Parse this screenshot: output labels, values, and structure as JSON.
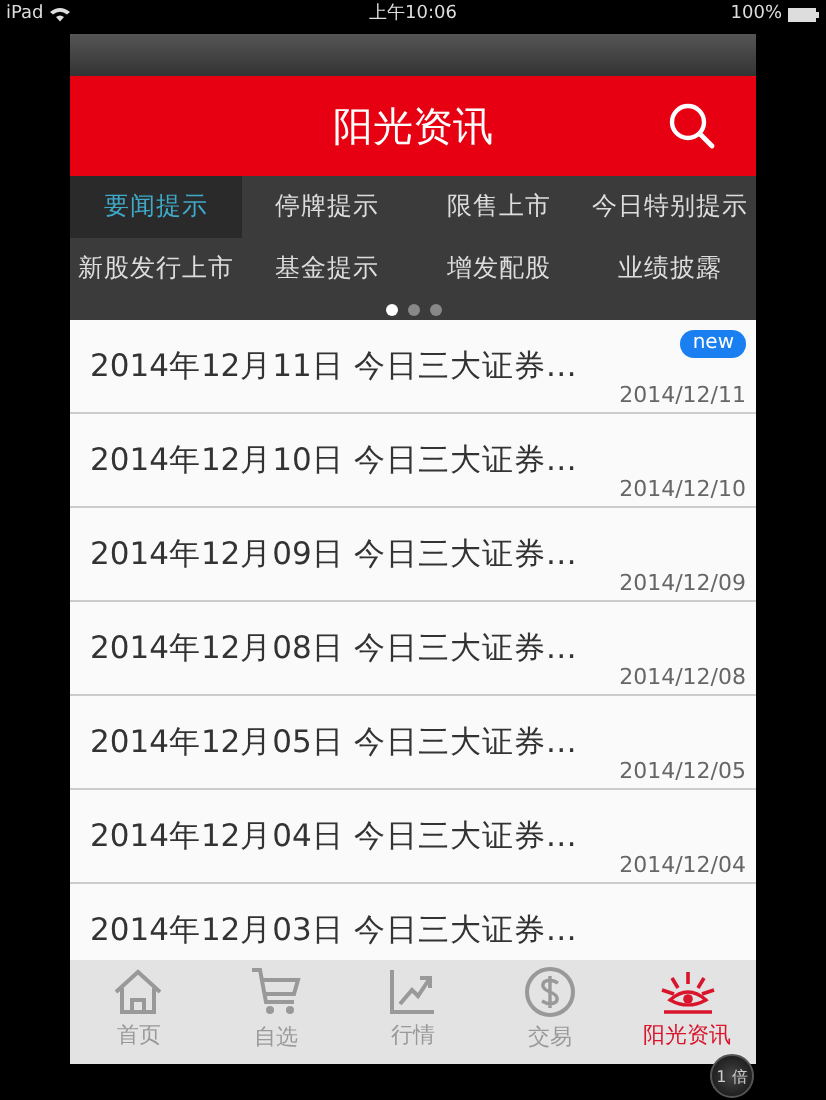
{
  "status_bar": {
    "device": "iPad",
    "time": "上午10:06",
    "battery": "100%"
  },
  "header": {
    "title": "阳光资讯"
  },
  "categories": [
    {
      "label": "要闻提示",
      "selected": true
    },
    {
      "label": "停牌提示",
      "selected": false
    },
    {
      "label": "限售上市",
      "selected": false
    },
    {
      "label": "今日特别提示",
      "selected": false
    },
    {
      "label": "新股发行上市",
      "selected": false
    },
    {
      "label": "基金提示",
      "selected": false
    },
    {
      "label": "增发配股",
      "selected": false
    },
    {
      "label": "业绩披露",
      "selected": false
    }
  ],
  "pages": [
    {
      "selected": true
    },
    {
      "selected": false
    },
    {
      "selected": false
    }
  ],
  "news": [
    {
      "title": "2014年12月11日 今日三大证券…",
      "date": "2014/12/11",
      "badge": "new"
    },
    {
      "title": "2014年12月10日 今日三大证券…",
      "date": "2014/12/10"
    },
    {
      "title": "2014年12月09日 今日三大证券…",
      "date": "2014/12/09"
    },
    {
      "title": "2014年12月08日 今日三大证券…",
      "date": "2014/12/08"
    },
    {
      "title": "2014年12月05日 今日三大证券…",
      "date": "2014/12/05"
    },
    {
      "title": "2014年12月04日 今日三大证券…",
      "date": "2014/12/04"
    },
    {
      "title": "2014年12月03日 今日三大证券…"
    }
  ],
  "tab_bar": [
    {
      "kind": "home",
      "label": "首页",
      "selected": false
    },
    {
      "kind": "cart",
      "label": "自选",
      "selected": false
    },
    {
      "kind": "chart",
      "label": "行情",
      "selected": false
    },
    {
      "kind": "dollar",
      "label": "交易",
      "selected": false
    },
    {
      "kind": "sun",
      "label": "阳光资讯",
      "selected": true
    }
  ],
  "zoom_button": "1 倍"
}
